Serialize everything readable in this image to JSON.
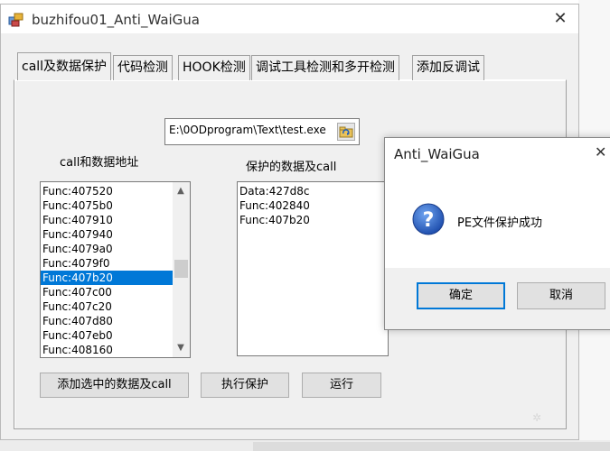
{
  "window": {
    "title": "buzhifou01_Anti_WaiGua",
    "close_glyph": "✕"
  },
  "tabs": [
    {
      "label": "call及数据保护"
    },
    {
      "label": "代码检测"
    },
    {
      "label": "HOOK检测"
    },
    {
      "label": "调试工具检测和多开检测"
    },
    {
      "label": "添加反调试"
    }
  ],
  "file_path": "E:\\0ODprogram\\Text\\test.exe",
  "left_list": {
    "label": "call和数据地址",
    "items": [
      "Func:407520",
      "Func:4075b0",
      "Func:407910",
      "Func:407940",
      "Func:4079a0",
      "Func:4079f0",
      "Func:407b20",
      "Func:407c00",
      "Func:407c20",
      "Func:407d80",
      "Func:407eb0",
      "Func:408160"
    ],
    "selected_index": 6
  },
  "right_list": {
    "label": "保护的数据及call",
    "items": [
      "Data:427d8c",
      "Func:402840",
      "Func:407b20"
    ]
  },
  "buttons": {
    "add_selected": "添加选中的数据及call",
    "protect": "执行保护",
    "run": "运行"
  },
  "dialog": {
    "title": "Anti_WaiGua",
    "close_glyph": "✕",
    "message": "PE文件保护成功",
    "icon": "question-icon",
    "ok": "确定",
    "cancel": "取消"
  },
  "colors": {
    "selection": "#0078d7",
    "window_bg": "#f0f0f0",
    "dialog_icon": "#1f5fbf"
  }
}
